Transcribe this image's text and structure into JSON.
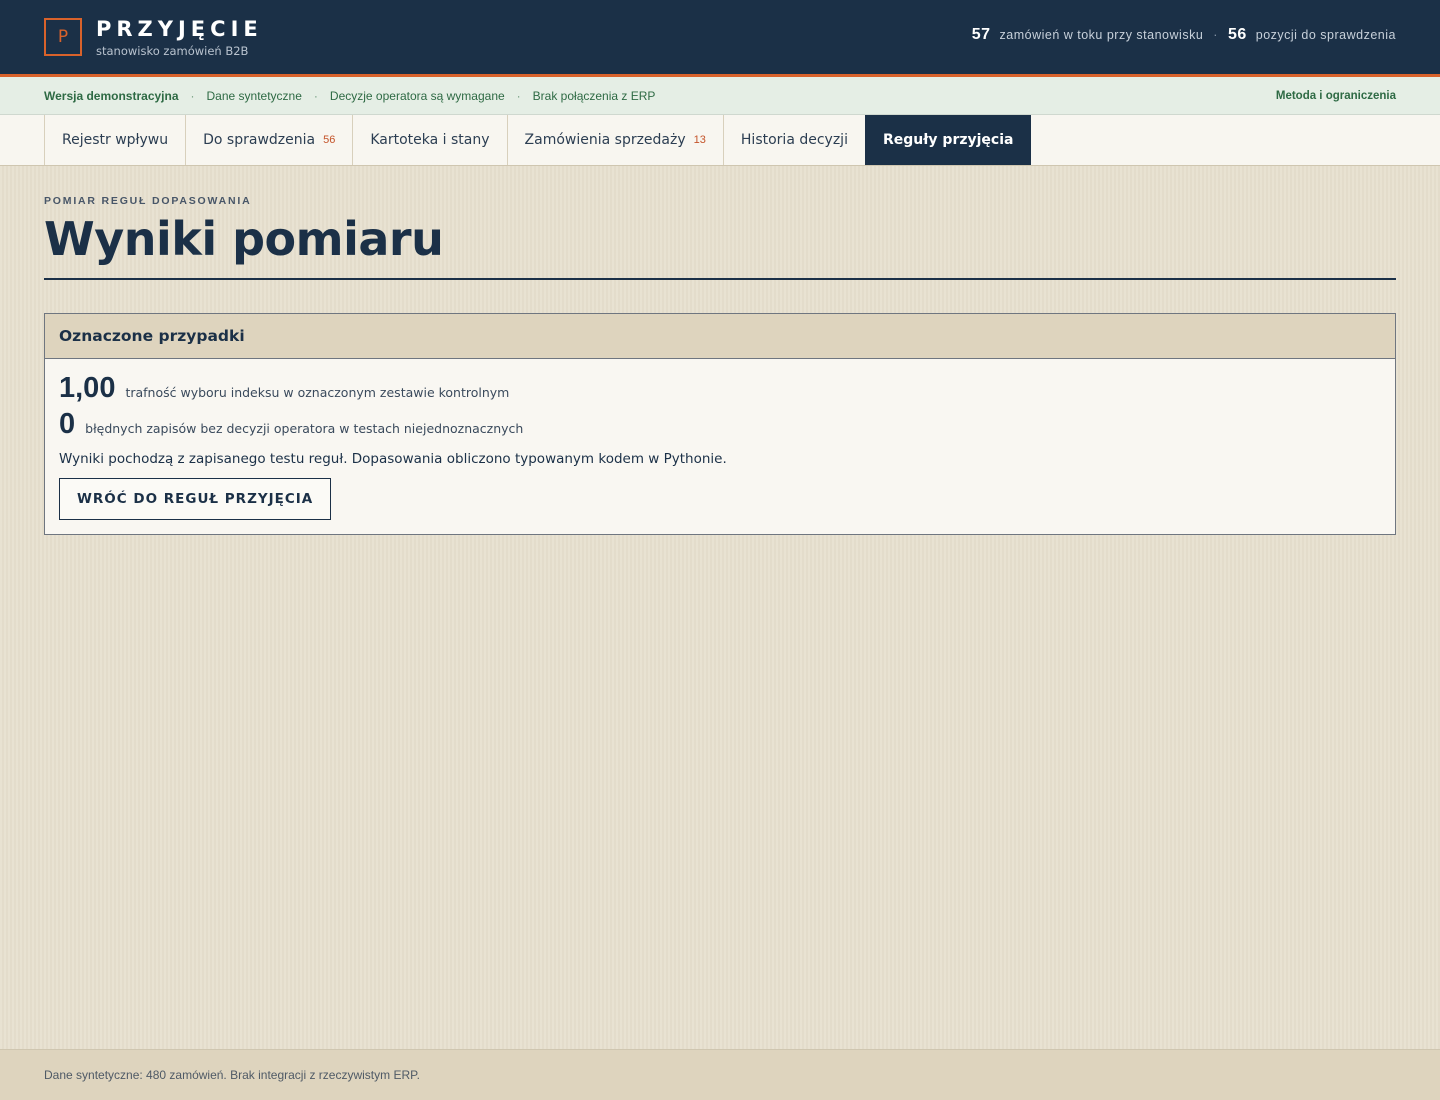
{
  "header": {
    "logo_letter": "P",
    "title": "PRZYJĘCIE",
    "subtitle": "stanowisko zamówień B2B",
    "stats": [
      {
        "value": "57",
        "label": "zamówień w toku przy stanowisku"
      },
      {
        "value": "56",
        "label": "pozycji do sprawdzenia"
      }
    ],
    "separator": "·"
  },
  "demo_strip": {
    "items": [
      "Wersja demonstracyjna",
      "Dane syntetyczne",
      "Decyzje operatora są wymagane",
      "Brak połączenia z ERP"
    ],
    "separator": "·",
    "link": "Metoda i ograniczenia"
  },
  "tabs": [
    {
      "label": "Rejestr wpływu",
      "count": ""
    },
    {
      "label": "Do sprawdzenia",
      "count": "56"
    },
    {
      "label": "Kartoteka i stany",
      "count": ""
    },
    {
      "label": "Zamówienia sprzedaży",
      "count": "13"
    },
    {
      "label": "Historia decyzji",
      "count": ""
    },
    {
      "label": "Reguły przyjęcia",
      "count": "",
      "active": true
    }
  ],
  "main": {
    "eyebrow": "POMIAR REGUŁ DOPASOWANIA",
    "title": "Wyniki pomiaru",
    "card": {
      "heading": "Oznaczone przypadki",
      "metrics": [
        {
          "value": "1,00",
          "label": "trafność wyboru indeksu w oznaczonym zestawie kontrolnym"
        },
        {
          "value": "0",
          "label": "błędnych zapisów bez decyzji operatora w testach niejednoznacznych"
        }
      ],
      "note": "Wyniki pochodzą z zapisanego testu reguł. Dopasowania obliczono typowanym kodem w Pythonie.",
      "button": "WRÓĆ DO REGUŁ PRZYJĘCIA"
    }
  },
  "footer": {
    "text": "Dane syntetyczne: 480 zamówień. Brak integracji z rzeczywistym ERP."
  },
  "colors": {
    "navy": "#1b3047",
    "accent_orange": "#d9622b",
    "demo_green": "#2e6a44",
    "background": "#e6dfcd"
  }
}
